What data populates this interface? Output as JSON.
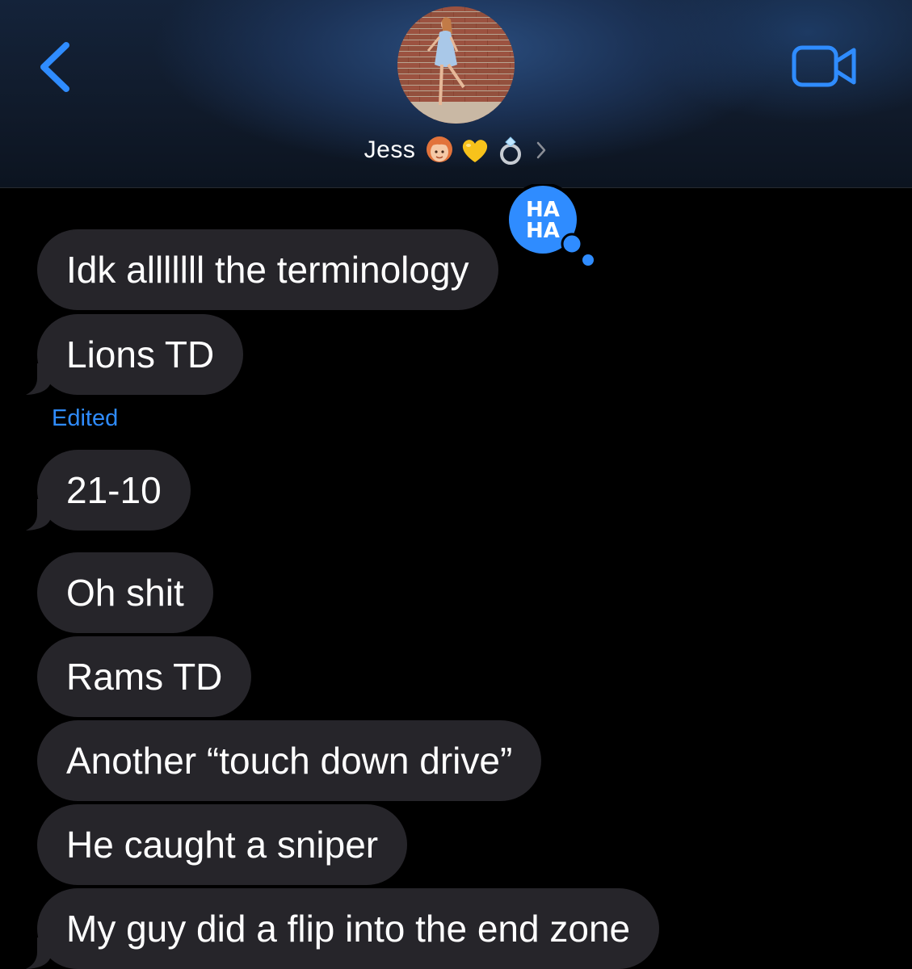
{
  "header": {
    "contact_name": "Jess",
    "name_emojis": [
      "woman-red-hair-emoji",
      "yellow-heart-emoji",
      "ring-emoji"
    ],
    "back_icon": "chevron-left-icon",
    "video_icon": "video-camera-icon",
    "accent_color": "#2f8cff"
  },
  "messages": [
    {
      "text": "Idk alllllll the terminology",
      "tapback": "HA HA"
    },
    {
      "text": "Lions TD"
    },
    {
      "text": "21-10",
      "status": "Edited"
    },
    {
      "text": "Oh shit"
    },
    {
      "text": "Rams TD"
    },
    {
      "text": "Another “touch down drive”"
    },
    {
      "text": "He caught a sniper"
    },
    {
      "text": "My guy did a flip into the end zone"
    }
  ],
  "colors": {
    "background": "#000000",
    "bubble": "#26252a",
    "bubble_text": "#ffffff",
    "edited_label": "#2f8cff",
    "tapback_bubble": "#2f8cff"
  }
}
